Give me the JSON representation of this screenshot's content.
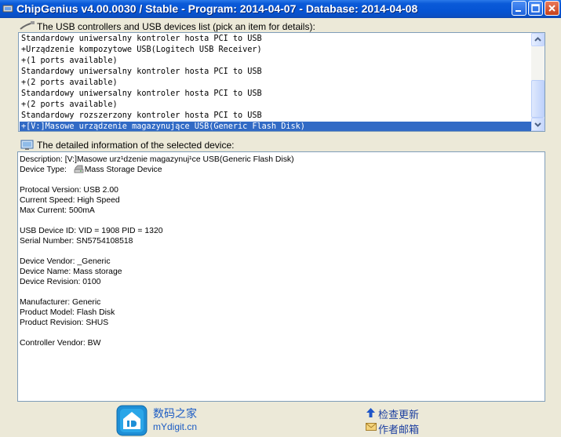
{
  "window": {
    "title": "ChipGenius v4.00.0030 / Stable - Program: 2014-04-07 - Database: 2014-04-08"
  },
  "devices_list": {
    "label": "The USB controllers and USB devices list (pick an item for details):",
    "items": [
      "Standardowy uniwersalny kontroler hosta PCI to USB",
      "+Urządzenie kompozytowe USB(Logitech USB Receiver)",
      "+(1 ports available)",
      "Standardowy uniwersalny kontroler hosta PCI to USB",
      "+(2 ports available)",
      "Standardowy uniwersalny kontroler hosta PCI to USB",
      "+(2 ports available)",
      "Standardowy rozszerzony kontroler hosta PCI to USB",
      "+[V:]Masowe urządzenie magazynujące USB(Generic Flash Disk)"
    ],
    "selected_index": 8
  },
  "details": {
    "label": "The detailed information of the selected device:",
    "description": "Description: [V:]Masowe urz¹dzenie magazynuj¹ce USB(Generic Flash Disk)",
    "device_type_label": "Device Type:",
    "device_type_value": "Mass Storage Device",
    "protocol_version": "Protocal Version: USB 2.00",
    "current_speed": "Current Speed: High Speed",
    "max_current": "Max Current: 500mA",
    "usb_device_id": "USB Device ID: VID = 1908 PID = 1320",
    "serial_number": "Serial Number: SN5754108518",
    "device_vendor": "Device Vendor: _Generic",
    "device_name": "Device Name: Mass storage",
    "device_revision": "Device Revision: 0100",
    "manufacturer": "Manufacturer: Generic",
    "product_model": "Product Model: Flash Disk",
    "product_revision": "Product Revision: SHUS",
    "controller_vendor": "Controller Vendor: BW"
  },
  "footer": {
    "brand_cn": "数码之家",
    "brand_url": "mYdigit.cn",
    "check_update": "检查更新",
    "author_email": "作者邮箱"
  },
  "colors": {
    "titlebar": "#0654d4",
    "selection": "#316ac5",
    "window_bg": "#ece9d8",
    "footer_text": "#1c5cc4"
  }
}
